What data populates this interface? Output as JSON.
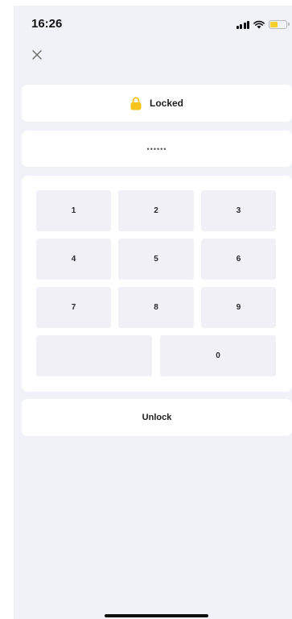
{
  "status_bar": {
    "time": "16:26",
    "battery_color": "#f6cf2e"
  },
  "header": {
    "close_icon": "close-icon"
  },
  "lock_status": {
    "label": "Locked",
    "icon": "padlock-icon",
    "icon_color": "#f6c21c"
  },
  "pin_input": {
    "masked_value": "••••••"
  },
  "keypad": {
    "keys": [
      "1",
      "2",
      "3",
      "4",
      "5",
      "6",
      "7",
      "8",
      "9",
      "",
      "0"
    ]
  },
  "actions": {
    "unlock_label": "Unlock"
  },
  "colors": {
    "background": "#f1f1f8",
    "card": "#ffffff",
    "key": "#f0f0f6",
    "accent": "#f6c21c"
  }
}
